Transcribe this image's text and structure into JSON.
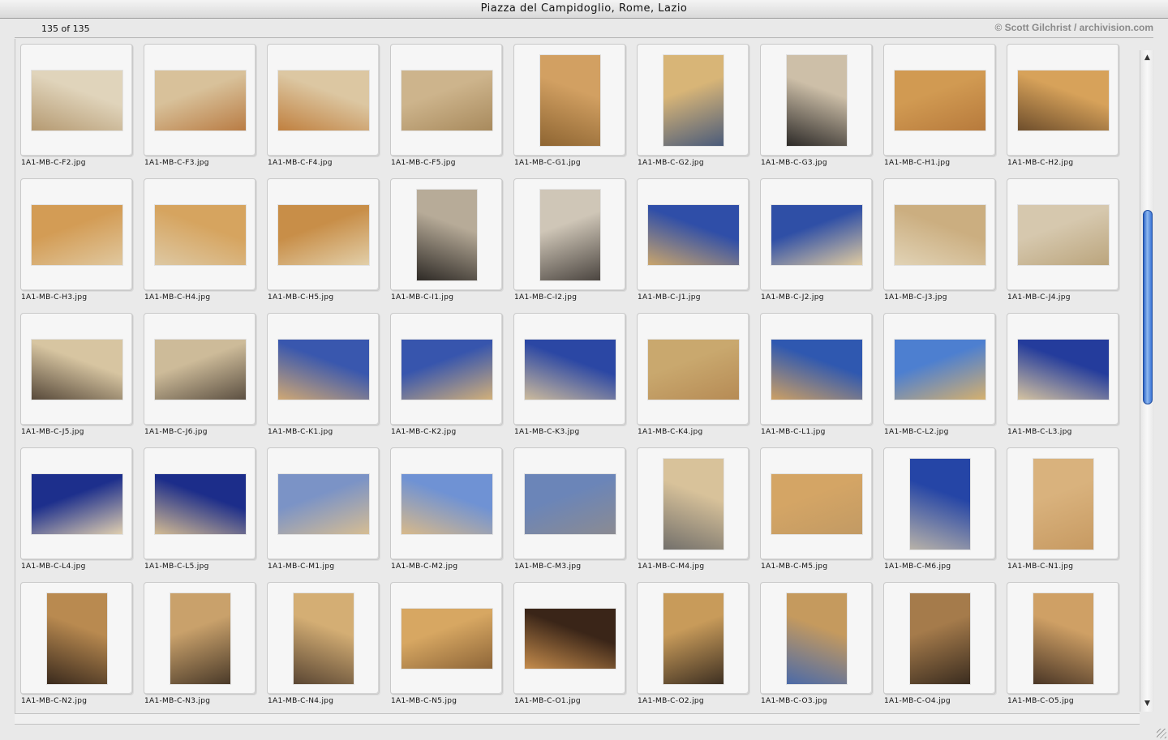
{
  "window": {
    "title": "Piazza del Campidoglio, Rome, Lazio",
    "count_label": "135 of 135",
    "credit": "© Scott Gilchrist / archivision.com"
  },
  "scrollbar": {
    "up_icon": "arrow-up-icon",
    "down_icon": "arrow-down-icon",
    "position_fraction": 0.33
  },
  "colors": {
    "sky_blue": "#2a48a8",
    "stone": "#d9c6a4",
    "ochre": "#c8954a",
    "dark": "#3a2e22"
  },
  "images": [
    {
      "file": "1A1-MB-C-F2.jpg",
      "orient": "land",
      "palette": [
        "#e0d4bb",
        "#b59a72"
      ]
    },
    {
      "file": "1A1-MB-C-F3.jpg",
      "orient": "land",
      "palette": [
        "#d8c19a",
        "#b97c44"
      ]
    },
    {
      "file": "1A1-MB-C-F4.jpg",
      "orient": "land",
      "palette": [
        "#dcc7a2",
        "#c0803f"
      ]
    },
    {
      "file": "1A1-MB-C-F5.jpg",
      "orient": "land",
      "palette": [
        "#cdb48c",
        "#a88a5d"
      ]
    },
    {
      "file": "1A1-MB-C-G1.jpg",
      "orient": "port",
      "palette": [
        "#d2a062",
        "#8e6532"
      ]
    },
    {
      "file": "1A1-MB-C-G2.jpg",
      "orient": "port",
      "palette": [
        "#d8b577",
        "#4a5b7a"
      ]
    },
    {
      "file": "1A1-MB-C-G3.jpg",
      "orient": "port",
      "palette": [
        "#cdbfa8",
        "#2d2a28"
      ]
    },
    {
      "file": "1A1-MB-C-H1.jpg",
      "orient": "land",
      "palette": [
        "#d19a52",
        "#b77a3c"
      ]
    },
    {
      "file": "1A1-MB-C-H2.jpg",
      "orient": "land",
      "palette": [
        "#d7a25a",
        "#6e4e2c"
      ]
    },
    {
      "file": "1A1-MB-C-H3.jpg",
      "orient": "land",
      "palette": [
        "#d39c55",
        "#e0c89f"
      ]
    },
    {
      "file": "1A1-MB-C-H4.jpg",
      "orient": "land",
      "palette": [
        "#d6a45f",
        "#ddc8a3"
      ]
    },
    {
      "file": "1A1-MB-C-H5.jpg",
      "orient": "land",
      "palette": [
        "#c88e48",
        "#e2cfa9"
      ]
    },
    {
      "file": "1A1-MB-C-I1.jpg",
      "orient": "port",
      "palette": [
        "#b7ab98",
        "#2e2a26"
      ]
    },
    {
      "file": "1A1-MB-C-I2.jpg",
      "orient": "port",
      "palette": [
        "#cfc6b7",
        "#4b4540"
      ]
    },
    {
      "file": "1A1-MB-C-J1.jpg",
      "orient": "land",
      "palette": [
        "#2f4ea8",
        "#c9a56c"
      ]
    },
    {
      "file": "1A1-MB-C-J2.jpg",
      "orient": "land",
      "palette": [
        "#2f4fa6",
        "#e0cba1"
      ]
    },
    {
      "file": "1A1-MB-C-J3.jpg",
      "orient": "land",
      "palette": [
        "#cbae80",
        "#e1d3b6"
      ]
    },
    {
      "file": "1A1-MB-C-J4.jpg",
      "orient": "land",
      "palette": [
        "#d6c8ae",
        "#bba57d"
      ]
    },
    {
      "file": "1A1-MB-C-J5.jpg",
      "orient": "land",
      "palette": [
        "#d7c5a1",
        "#57493a"
      ]
    },
    {
      "file": "1A1-MB-C-J6.jpg",
      "orient": "land",
      "palette": [
        "#cdbb99",
        "#5c5042"
      ]
    },
    {
      "file": "1A1-MB-C-K1.jpg",
      "orient": "land",
      "palette": [
        "#3957ae",
        "#d0a874"
      ]
    },
    {
      "file": "1A1-MB-C-K2.jpg",
      "orient": "land",
      "palette": [
        "#3755ad",
        "#d2b07a"
      ]
    },
    {
      "file": "1A1-MB-C-K3.jpg",
      "orient": "land",
      "palette": [
        "#2b47a4",
        "#cdbb9c"
      ]
    },
    {
      "file": "1A1-MB-C-K4.jpg",
      "orient": "land",
      "palette": [
        "#c9a86e",
        "#b68b55"
      ]
    },
    {
      "file": "1A1-MB-C-L1.jpg",
      "orient": "land",
      "palette": [
        "#2f58b0",
        "#cda064"
      ]
    },
    {
      "file": "1A1-MB-C-L2.jpg",
      "orient": "land",
      "palette": [
        "#4d7fd0",
        "#d5b06e"
      ]
    },
    {
      "file": "1A1-MB-C-L3.jpg",
      "orient": "land",
      "palette": [
        "#243c9c",
        "#d5c3a0"
      ]
    },
    {
      "file": "1A1-MB-C-L4.jpg",
      "orient": "land",
      "palette": [
        "#1d2f8c",
        "#e0cfb0"
      ]
    },
    {
      "file": "1A1-MB-C-L5.jpg",
      "orient": "land",
      "palette": [
        "#1c2d8a",
        "#d3bb93"
      ]
    },
    {
      "file": "1A1-MB-C-M1.jpg",
      "orient": "land",
      "palette": [
        "#7b93c6",
        "#d6bd93"
      ]
    },
    {
      "file": "1A1-MB-C-M2.jpg",
      "orient": "land",
      "palette": [
        "#6f92d4",
        "#d8b98a"
      ]
    },
    {
      "file": "1A1-MB-C-M3.jpg",
      "orient": "land",
      "palette": [
        "#6b85b8",
        "#8b8b92"
      ]
    },
    {
      "file": "1A1-MB-C-M4.jpg",
      "orient": "port",
      "palette": [
        "#d8c29a",
        "#73706b"
      ]
    },
    {
      "file": "1A1-MB-C-M5.jpg",
      "orient": "land",
      "palette": [
        "#d4a565",
        "#c29a64"
      ]
    },
    {
      "file": "1A1-MB-C-M6.jpg",
      "orient": "port",
      "palette": [
        "#2545a6",
        "#b8b2a8"
      ]
    },
    {
      "file": "1A1-MB-C-N1.jpg",
      "orient": "port",
      "palette": [
        "#d9b27d",
        "#c79a62"
      ]
    },
    {
      "file": "1A1-MB-C-N2.jpg",
      "orient": "port",
      "palette": [
        "#b98a50",
        "#3a2a1d"
      ]
    },
    {
      "file": "1A1-MB-C-N3.jpg",
      "orient": "port",
      "palette": [
        "#c9a16b",
        "#4a3a29"
      ]
    },
    {
      "file": "1A1-MB-C-N4.jpg",
      "orient": "port",
      "palette": [
        "#d4ae74",
        "#5a4633"
      ]
    },
    {
      "file": "1A1-MB-C-N5.jpg",
      "orient": "land",
      "palette": [
        "#d7a762",
        "#8d6538"
      ]
    },
    {
      "file": "1A1-MB-C-O1.jpg",
      "orient": "land",
      "palette": [
        "#3a2518",
        "#c58c4c"
      ]
    },
    {
      "file": "1A1-MB-C-O2.jpg",
      "orient": "port",
      "palette": [
        "#c89b5a",
        "#3e3022"
      ]
    },
    {
      "file": "1A1-MB-C-O3.jpg",
      "orient": "port",
      "palette": [
        "#c59a5e",
        "#4b6aa8"
      ]
    },
    {
      "file": "1A1-MB-C-O4.jpg",
      "orient": "port",
      "palette": [
        "#a57b4b",
        "#3a2c1f"
      ]
    },
    {
      "file": "1A1-MB-C-O5.jpg",
      "orient": "port",
      "palette": [
        "#cfa065",
        "#4a3626"
      ]
    }
  ]
}
